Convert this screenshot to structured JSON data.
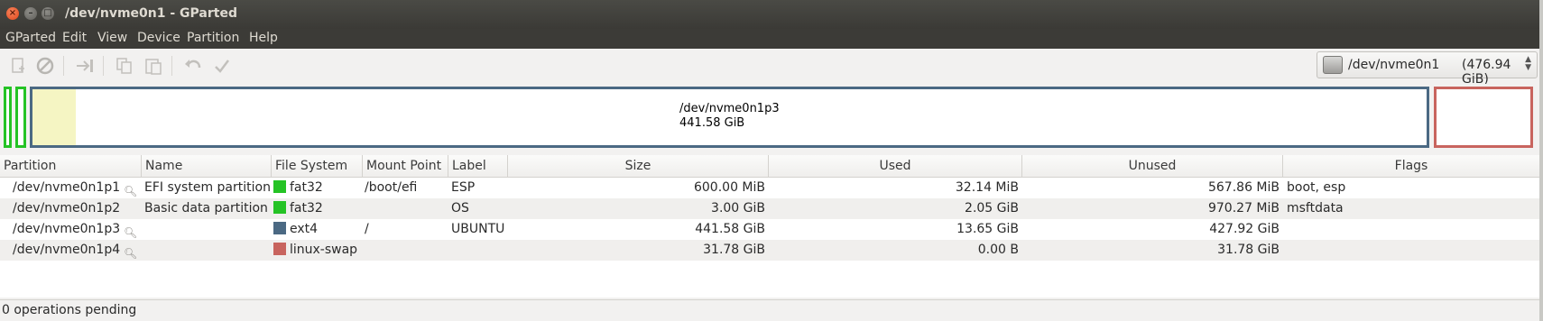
{
  "window": {
    "title": "/dev/nvme0n1 - GParted"
  },
  "menu": [
    "GParted",
    "Edit",
    "View",
    "Device",
    "Partition",
    "Help"
  ],
  "toolbar": {
    "icons": [
      "new-partition-icon",
      "delete-icon",
      "resize-move-icon",
      "copy-icon",
      "paste-icon",
      "undo-icon",
      "apply-icon"
    ]
  },
  "device_selector": {
    "device": "/dev/nvme0n1",
    "size": "(476.94 GiB)"
  },
  "map": {
    "selected_name": "/dev/nvme0n1p3",
    "selected_size": "441.58 GiB"
  },
  "colors": {
    "fat32": "#25c325",
    "ext4": "#4b6983",
    "linux-swap": "#c8645e",
    "used": "#f5f5c3"
  },
  "table": {
    "headers": [
      "Partition",
      "Name",
      "File System",
      "Mount Point",
      "Label",
      "Size",
      "Used",
      "Unused",
      "Flags"
    ],
    "rows": [
      {
        "partition": "/dev/nvme0n1p1",
        "name": "EFI system partition",
        "fs": "fat32",
        "mount": "/boot/efi",
        "label": "ESP",
        "size": "600.00 MiB",
        "used": "32.14 MiB",
        "unused": "567.86 MiB",
        "flags": "boot, esp"
      },
      {
        "partition": "/dev/nvme0n1p2",
        "name": "Basic data partition",
        "fs": "fat32",
        "mount": "",
        "label": "OS",
        "size": "3.00 GiB",
        "used": "2.05 GiB",
        "unused": "970.27 MiB",
        "flags": "msftdata"
      },
      {
        "partition": "/dev/nvme0n1p3",
        "name": "",
        "fs": "ext4",
        "mount": "/",
        "label": "UBUNTU",
        "size": "441.58 GiB",
        "used": "13.65 GiB",
        "unused": "427.92 GiB",
        "flags": ""
      },
      {
        "partition": "/dev/nvme0n1p4",
        "name": "",
        "fs": "linux-swap",
        "mount": "",
        "label": "",
        "size": "31.78 GiB",
        "used": "0.00 B",
        "unused": "31.78 GiB",
        "flags": ""
      }
    ]
  },
  "status": "0 operations pending"
}
